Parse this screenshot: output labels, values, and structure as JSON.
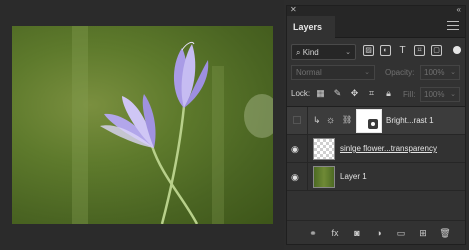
{
  "panel": {
    "close_glyph": "✕",
    "collapse_glyph": "«",
    "tab_label": "Layers",
    "filter": {
      "kind_label": "Kind",
      "icons": [
        "image-icon",
        "adjustment-icon",
        "type-icon",
        "shape-icon",
        "smart-object-icon"
      ]
    },
    "blend": {
      "mode": "Normal",
      "opacity_label": "Opacity:",
      "opacity_value": "100%"
    },
    "lock": {
      "label": "Lock:",
      "fill_label": "Fill:",
      "fill_value": "100%"
    },
    "layers": [
      {
        "name": "Bright...rast 1",
        "type": "adjustment",
        "visible": false,
        "clipped": true
      },
      {
        "name": "sinlge flower...transparency",
        "type": "pixel",
        "visible": true
      },
      {
        "name": "Layer 1",
        "type": "pixel",
        "visible": true
      }
    ],
    "bottom_icons": [
      "link-icon",
      "fx-icon",
      "mask-icon",
      "new-fill-adjustment-icon",
      "folder-icon",
      "new-layer-icon",
      "trash-icon"
    ],
    "fx_label": "fx"
  }
}
